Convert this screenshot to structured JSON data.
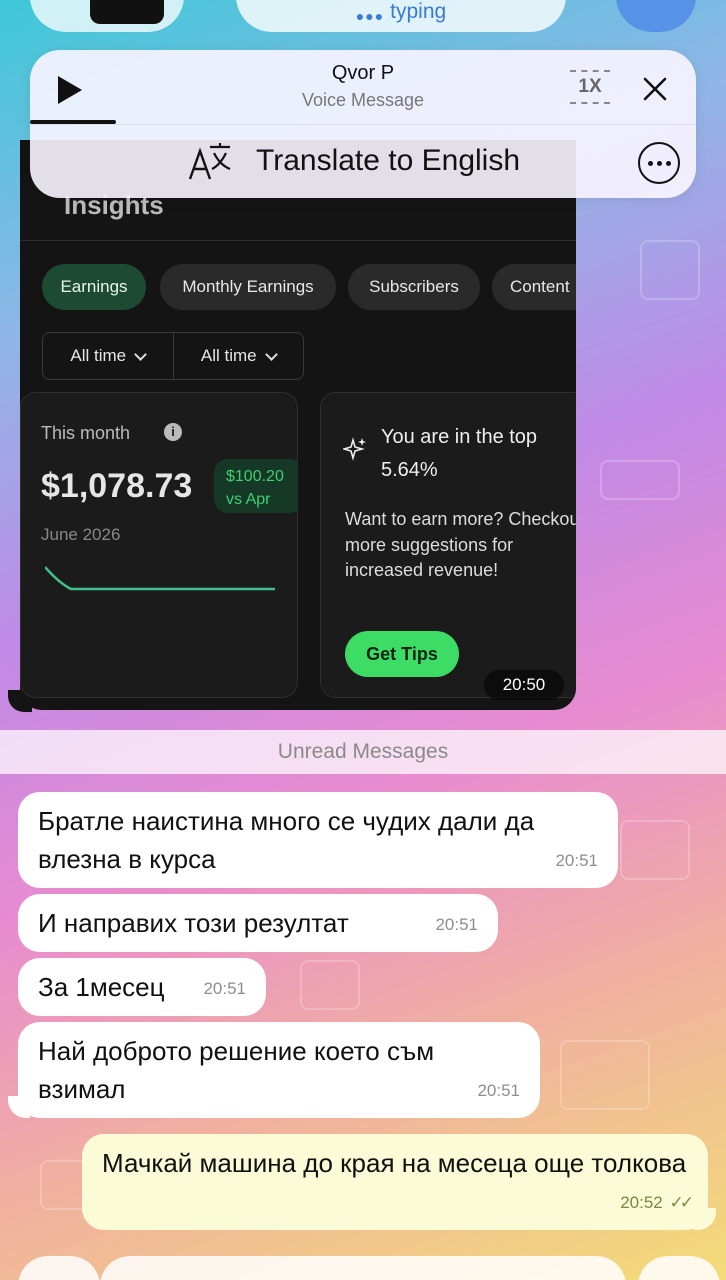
{
  "header": {
    "typing_status": "typing"
  },
  "voice_message": {
    "sender": "Qvor P",
    "subtitle": "Voice Message",
    "speed": "1X",
    "translate_label": "Translate to English"
  },
  "image_message": {
    "section_title": "Insights",
    "tabs": [
      "Earnings",
      "Monthly Earnings",
      "Subscribers",
      "Content"
    ],
    "filters": [
      "All time",
      "All time"
    ],
    "month_card": {
      "label": "This month",
      "info_icon": "i",
      "amount": "$1,078.73",
      "delta_line1": "$100.20",
      "delta_line2": "vs Apr",
      "date": "June 2026"
    },
    "tips_card": {
      "headline_line1": "You are in the top",
      "headline_line2": "5.64%",
      "body": "Want to earn more? Checkout more suggestions for increased revenue!",
      "button": "Get Tips"
    },
    "time": "20:50"
  },
  "unread_label": "Unread Messages",
  "messages": [
    {
      "text": "Братле наистина много се чудих дали да влезна в курса",
      "time": "20:51",
      "direction": "in"
    },
    {
      "text": "И направих този резултат",
      "time": "20:51",
      "direction": "in"
    },
    {
      "text": "За 1месец",
      "time": "20:51",
      "direction": "in"
    },
    {
      "text": "Най доброто решение което съм взимал",
      "time": "20:51",
      "direction": "in"
    },
    {
      "text": "Мачкай машина до края на месеца още толкова",
      "time": "20:52",
      "direction": "out",
      "read": "✓✓"
    }
  ],
  "colors": {
    "accent_green": "#3ddc64",
    "typing_blue": "#3a7bd5",
    "outgoing_bubble": "#fbfbd8"
  }
}
